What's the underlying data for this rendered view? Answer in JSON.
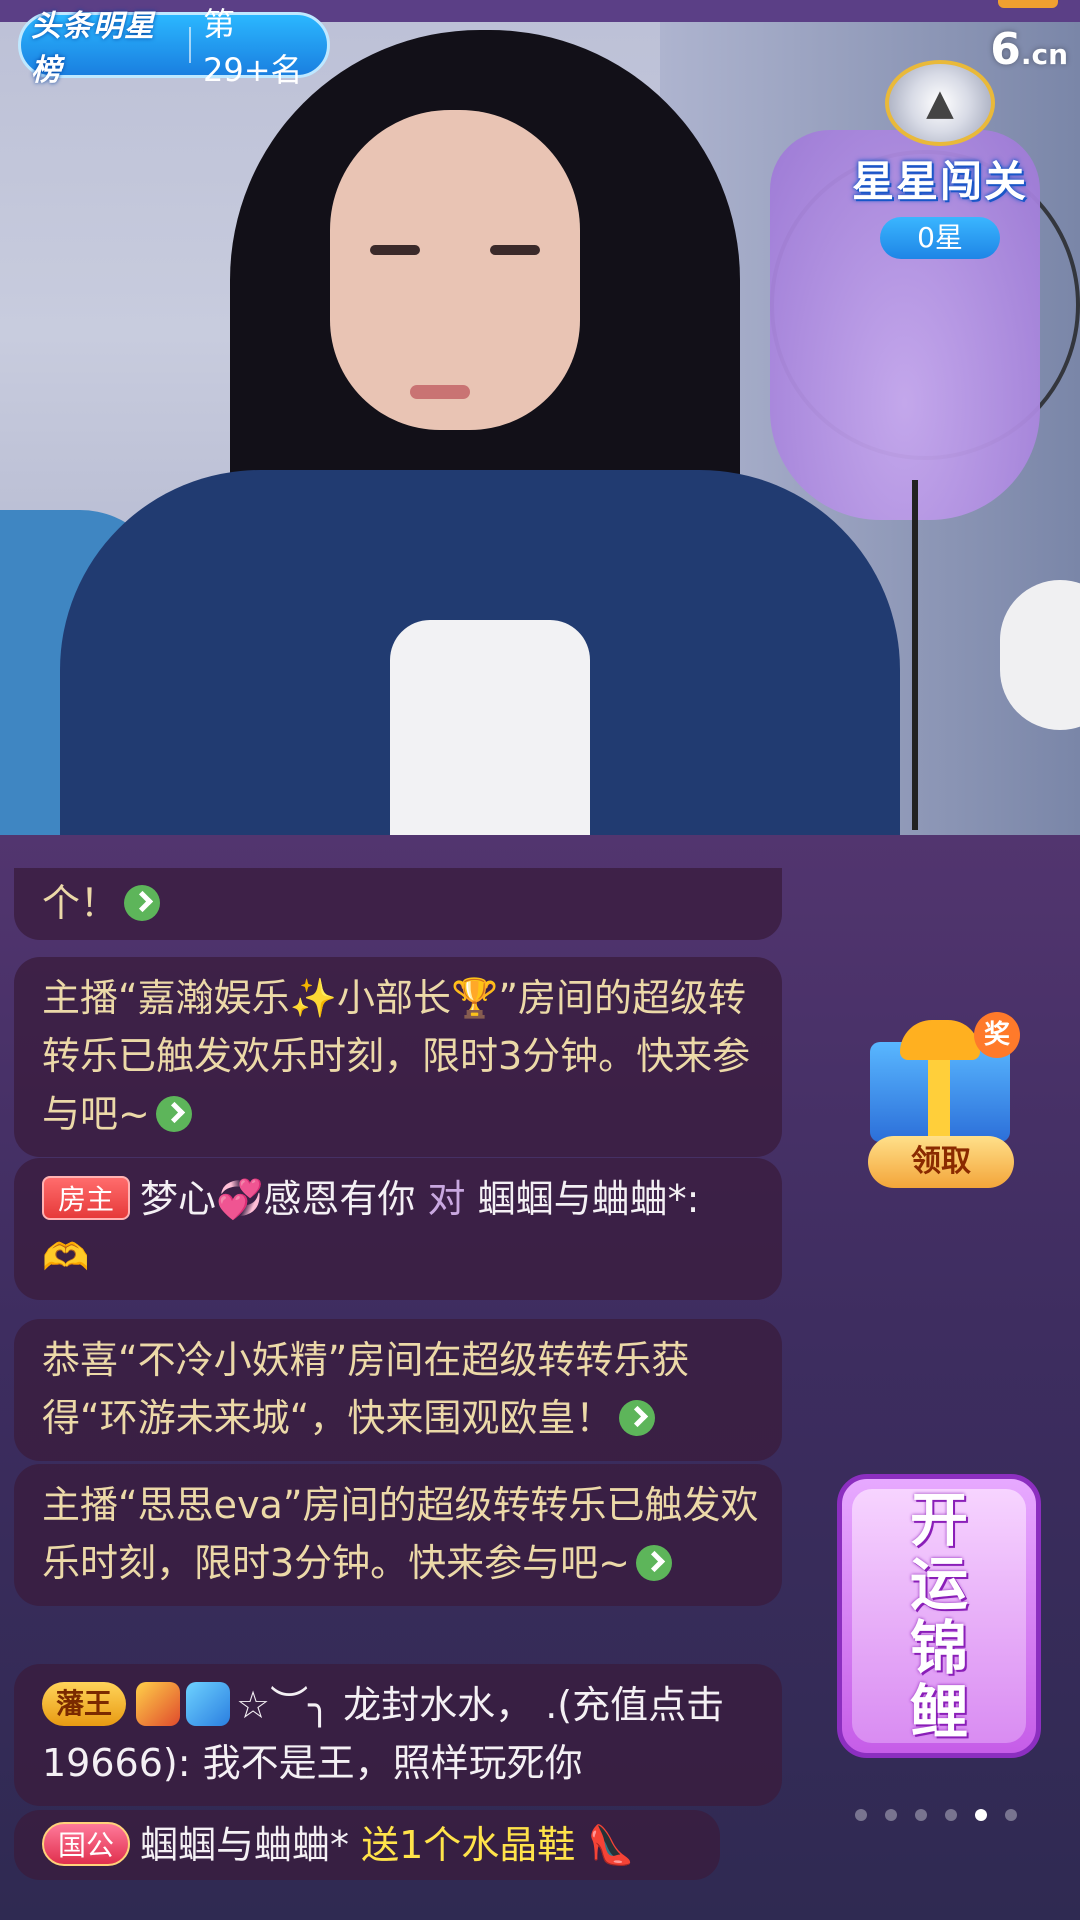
{
  "colors": {
    "accent_green": "#5db55a",
    "chat_gold": "#ecd9a8",
    "gift_yellow": "#ffe34a",
    "badge_blue": "#1a7fe0"
  },
  "video": {
    "rank_badge": {
      "logo": "头条明星榜",
      "rank": "第29+名"
    },
    "site_logo": {
      "num": "6",
      "suffix": ".cn"
    },
    "star_game": {
      "title": "星星闯关",
      "count": "0星",
      "icon": "warning-medal-icon"
    }
  },
  "chat": {
    "messages": [
      {
        "text": "个！"
      },
      {
        "prefix": "主播“嘉瀚娱乐",
        "sparkle": "✨",
        "mid": "小部长",
        "trophy": "🏆",
        "suffix": "”房间的超级转转乐已触发欢乐时刻，限时3分钟。快来参与吧~"
      },
      {
        "tag": "房主",
        "user": "梦心",
        "heart": "💞",
        "user2": "感恩有你",
        "to": "对",
        "target": "蝈蝈与蛐蛐*:",
        "emoji": "🫶"
      },
      {
        "text": "恭喜“不冷小妖精”房间在超级转转乐获得“环游未来城“，快来围观欧皇！"
      },
      {
        "text": "主播“思思eva”房间的超级转转乐已触发欢乐时刻，限时3分钟。快来参与吧~"
      },
      {
        "tag": "藩王",
        "symbol": "☆",
        "sym2": "︶╮",
        "name": "龙封水水，",
        "rest": ".(充值点击19666): 我不是王，照样玩死你"
      },
      {
        "tag": "国公",
        "user": "蝈蝈与蛐蛐*",
        "gift": "送1个水晶鞋",
        "gift_icon": "👠"
      }
    ]
  },
  "widgets": {
    "gift_box": {
      "prize_label": "奖",
      "claim_label": "领取"
    },
    "lucky_card": {
      "chars": [
        "开",
        "运",
        "锦",
        "鲤"
      ]
    },
    "carousel": {
      "count": 6,
      "active": 4
    }
  }
}
